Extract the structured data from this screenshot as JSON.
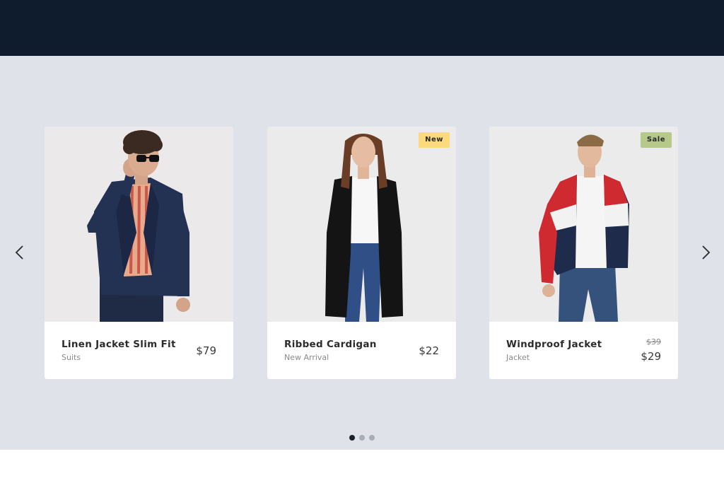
{
  "header": {},
  "carousel": {
    "prev_icon": "chevron-left-icon",
    "next_icon": "chevron-right-icon",
    "products": [
      {
        "name": "Linen Jacket Slim Fit",
        "category": "Suits",
        "price": "$79",
        "badge": ""
      },
      {
        "name": "Ribbed Cardigan",
        "category": "New Arrival",
        "price": "$22",
        "badge": "New"
      },
      {
        "name": "Windproof Jacket",
        "category": "Jacket",
        "old_price": "$39",
        "price": "$29",
        "badge": "Sale"
      }
    ],
    "pagination": {
      "total": 3,
      "active": 1
    }
  },
  "colors": {
    "header_bg": "#0f1c2e",
    "carousel_bg": "#dfe2e8",
    "badge_new": "#fbd97d",
    "badge_sale": "#b6c98a",
    "dot_active": "#1a1f2a",
    "dot_inactive": "#a8adb6"
  }
}
